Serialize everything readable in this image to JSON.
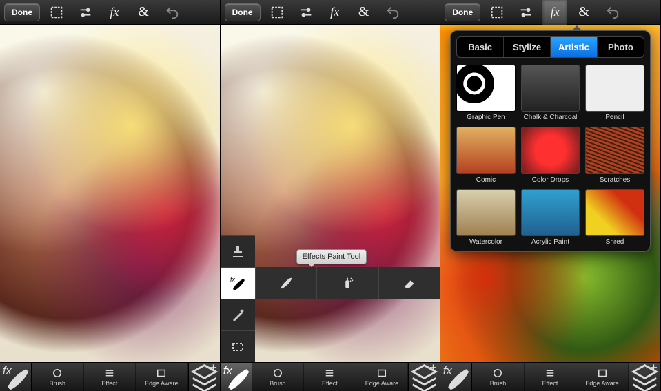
{
  "topbar": {
    "done_label": "Done"
  },
  "bottombar": {
    "brush_label": "Brush",
    "effect_label": "Effect",
    "edge_label": "Edge Aware"
  },
  "panel2": {
    "tooltip": "Effects Paint Tool"
  },
  "popover": {
    "tabs": {
      "basic": "Basic",
      "stylize": "Stylize",
      "artistic": "Artistic",
      "photo": "Photo"
    },
    "effects": [
      {
        "label": "Graphic Pen",
        "thumb": "th-graphic"
      },
      {
        "label": "Chalk & Charcoal",
        "thumb": "th-chalk"
      },
      {
        "label": "Pencil",
        "thumb": "th-pencil"
      },
      {
        "label": "Comic",
        "thumb": "th-comic"
      },
      {
        "label": "Color Drops",
        "thumb": "th-drops"
      },
      {
        "label": "Scratches",
        "thumb": "th-scratch"
      },
      {
        "label": "Watercolor",
        "thumb": "th-water"
      },
      {
        "label": "Acrylic Paint",
        "thumb": "th-acrylic"
      },
      {
        "label": "Shred",
        "thumb": "th-shred"
      }
    ]
  }
}
